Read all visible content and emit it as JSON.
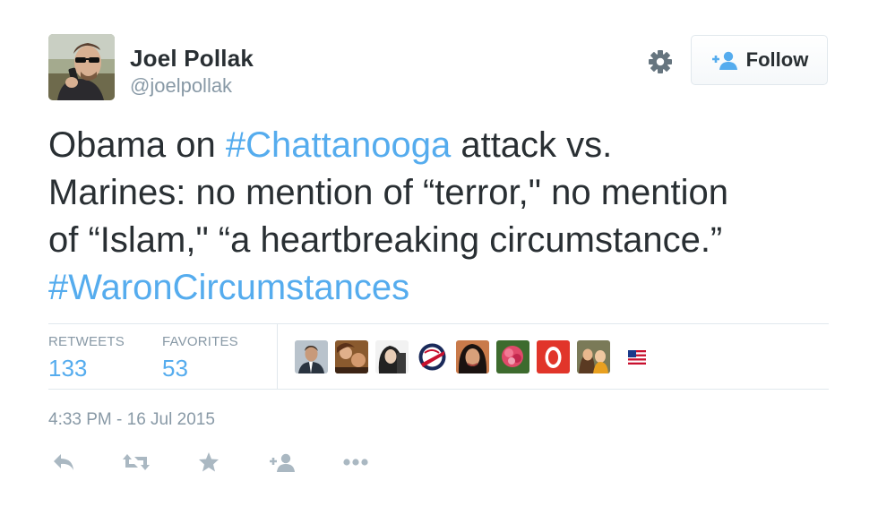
{
  "user": {
    "name": "Joel Pollak",
    "handle": "@joelpollak"
  },
  "follow_button": {
    "label": "Follow",
    "icon": "follow-user-icon"
  },
  "settings_icon": "gear-icon",
  "tweet": {
    "lines": [
      [
        {
          "text": "Obama on ",
          "hashtag": false
        },
        {
          "text": "#Chattanooga",
          "hashtag": true
        },
        {
          "text": " attack vs.",
          "hashtag": false
        }
      ],
      [
        {
          "text": "Marines: no mention of “terror,\" no mention",
          "hashtag": false
        }
      ],
      [
        {
          "text": "of “Islam,\" “a heartbreaking circumstance.”",
          "hashtag": false
        }
      ],
      [
        {
          "text": "#WaronCircumstances",
          "hashtag": true
        }
      ]
    ]
  },
  "stats": {
    "retweets_label": "RETWEETS",
    "retweets_value": "133",
    "favorites_label": "FAVORITES",
    "favorites_value": "53"
  },
  "favorited_by_avatar_count": 8,
  "flag_icon": "us-flag-icon",
  "timestamp": "4:33 PM - 16 Jul 2015",
  "actions": [
    "reply-icon",
    "retweet-icon",
    "favorite-icon",
    "follow-icon",
    "more-icon"
  ],
  "colors": {
    "link": "#55acee",
    "text": "#292f33",
    "muted": "#8899a6",
    "icon": "#aab8c2",
    "border": "#e1e8ed"
  }
}
